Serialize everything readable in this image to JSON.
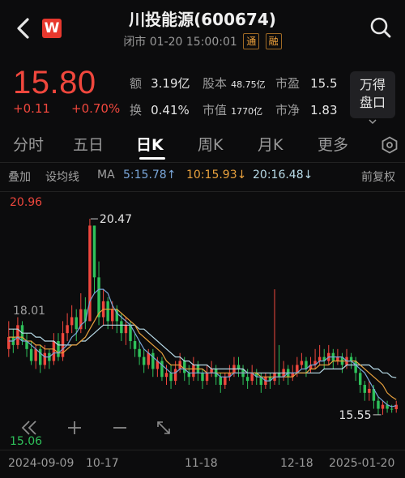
{
  "header": {
    "title": "川投能源(600674)",
    "status": "闭市 01-20 15:00:01",
    "badge1": "通",
    "badge2": "融",
    "logo_letter": "W"
  },
  "quote": {
    "price": "15.80",
    "change": "+0.11",
    "change_pct": "+0.70%",
    "amount_label": "额",
    "amount": "3.19亿",
    "equity_label": "股本",
    "equity": "48.75亿",
    "pe_label": "市盈",
    "pe": "15.5",
    "turnover_label": "换",
    "turnover": "0.41%",
    "mktcap_label": "市值",
    "mktcap": "1770亿",
    "pb_label": "市净",
    "pb": "1.83",
    "wande_line1": "万得",
    "wande_line2": "盘口"
  },
  "tabs": [
    "分时",
    "五日",
    "日K",
    "周K",
    "月K",
    "更多"
  ],
  "active_tab": "日K",
  "toolbar": {
    "overlay": "叠加",
    "drawline": "设均线",
    "ma_label": "MA",
    "ma5": "5:15.78↑",
    "ma10": "10:15.93↓",
    "ma20": "20:16.48↓",
    "adjust": "前复权"
  },
  "chart_data": {
    "type": "candlestick",
    "axis_high": "20.96",
    "axis_mid": "18.01",
    "axis_low": "15.06",
    "annotation_high": "20.47",
    "annotation_low": "15.55",
    "x_labels": [
      "2024-09-09",
      "10-17",
      "11-18",
      "12-18",
      "2025-01-20"
    ],
    "ylim": [
      15.06,
      20.96
    ],
    "colors": {
      "up": "#f0473d",
      "down": "#2ec15a",
      "ma5": "#7aa6d9",
      "ma10": "#e8a13d",
      "ma20": "#b8dbe8"
    },
    "candles": [
      [
        17.2,
        17.5,
        17.9,
        17.0
      ],
      [
        17.5,
        17.3,
        17.7,
        17.1
      ],
      [
        17.3,
        17.8,
        18.0,
        17.2
      ],
      [
        17.8,
        17.4,
        17.9,
        17.3
      ],
      [
        17.4,
        17.2,
        17.6,
        17.0
      ],
      [
        17.2,
        16.9,
        17.4,
        16.8
      ],
      [
        16.9,
        17.2,
        17.3,
        16.7
      ],
      [
        17.2,
        16.8,
        17.3,
        16.6
      ],
      [
        16.8,
        17.1,
        17.3,
        16.7
      ],
      [
        17.1,
        16.9,
        17.2,
        16.7
      ],
      [
        16.9,
        17.4,
        17.6,
        16.8
      ],
      [
        17.4,
        17.0,
        17.6,
        16.9
      ],
      [
        17.0,
        17.6,
        17.9,
        16.9
      ],
      [
        17.6,
        17.8,
        18.1,
        17.4
      ],
      [
        17.8,
        18.0,
        18.3,
        17.6
      ],
      [
        18.0,
        17.7,
        18.2,
        17.4
      ],
      [
        17.7,
        18.2,
        18.6,
        17.6
      ],
      [
        18.2,
        17.9,
        18.5,
        17.7
      ],
      [
        17.9,
        20.3,
        20.47,
        17.9
      ],
      [
        20.3,
        19.0,
        20.3,
        18.6
      ],
      [
        19.0,
        18.0,
        19.4,
        17.8
      ],
      [
        18.0,
        18.4,
        18.7,
        17.8
      ],
      [
        18.4,
        17.9,
        18.5,
        17.7
      ],
      [
        17.9,
        18.2,
        18.4,
        17.7
      ],
      [
        18.2,
        17.9,
        18.3,
        17.6
      ],
      [
        17.9,
        17.6,
        18.1,
        17.4
      ],
      [
        17.6,
        17.8,
        18.0,
        17.3
      ],
      [
        17.8,
        17.4,
        17.9,
        17.2
      ],
      [
        17.4,
        17.2,
        17.6,
        17.0
      ],
      [
        17.2,
        17.0,
        17.4,
        16.8
      ],
      [
        17.0,
        16.8,
        17.2,
        16.6
      ],
      [
        16.8,
        17.1,
        17.2,
        16.7
      ],
      [
        17.1,
        16.7,
        17.2,
        16.5
      ],
      [
        16.7,
        16.9,
        17.0,
        16.5
      ],
      [
        16.9,
        16.5,
        17.0,
        16.4
      ],
      [
        16.5,
        16.6,
        16.8,
        16.3
      ],
      [
        16.6,
        16.4,
        16.8,
        16.2
      ],
      [
        16.4,
        16.7,
        16.9,
        16.3
      ],
      [
        16.7,
        16.9,
        17.1,
        16.6
      ],
      [
        16.9,
        16.6,
        17.0,
        16.4
      ],
      [
        16.6,
        16.5,
        16.8,
        16.3
      ],
      [
        16.5,
        16.8,
        17.0,
        16.4
      ],
      [
        16.8,
        16.6,
        16.9,
        16.4
      ],
      [
        16.6,
        16.4,
        16.7,
        16.2
      ],
      [
        16.4,
        16.6,
        16.8,
        16.3
      ],
      [
        16.6,
        16.7,
        16.9,
        16.5
      ],
      [
        16.7,
        16.5,
        16.8,
        16.3
      ],
      [
        16.5,
        16.3,
        16.6,
        16.1
      ],
      [
        16.3,
        16.5,
        16.6,
        16.2
      ],
      [
        16.5,
        16.6,
        16.8,
        16.4
      ],
      [
        16.6,
        16.8,
        17.0,
        16.5
      ],
      [
        16.8,
        16.7,
        17.0,
        16.5
      ],
      [
        16.7,
        16.5,
        16.8,
        16.3
      ],
      [
        16.5,
        16.4,
        16.7,
        16.2
      ],
      [
        16.4,
        16.6,
        16.8,
        16.3
      ],
      [
        16.6,
        16.5,
        16.7,
        16.3
      ],
      [
        16.5,
        16.3,
        16.6,
        16.1
      ],
      [
        16.3,
        16.5,
        16.6,
        16.2
      ],
      [
        16.5,
        16.4,
        16.6,
        16.2
      ],
      [
        16.4,
        16.6,
        18.7,
        16.3
      ],
      [
        16.6,
        16.5,
        17.3,
        16.3
      ],
      [
        16.5,
        16.7,
        16.9,
        16.4
      ],
      [
        16.7,
        16.5,
        16.8,
        16.3
      ],
      [
        16.5,
        16.6,
        16.8,
        16.4
      ],
      [
        16.6,
        16.8,
        17.0,
        16.5
      ],
      [
        16.8,
        16.9,
        17.1,
        16.7
      ],
      [
        16.9,
        16.7,
        17.0,
        16.5
      ],
      [
        16.7,
        16.8,
        17.0,
        16.6
      ],
      [
        16.8,
        16.9,
        17.2,
        16.7
      ],
      [
        16.9,
        17.0,
        17.3,
        16.8
      ],
      [
        17.0,
        16.9,
        17.2,
        16.7
      ],
      [
        16.9,
        17.1,
        17.3,
        16.8
      ],
      [
        17.1,
        16.9,
        17.2,
        16.7
      ],
      [
        16.9,
        17.0,
        17.2,
        16.8
      ],
      [
        17.0,
        16.8,
        17.1,
        16.6
      ],
      [
        16.8,
        17.0,
        17.2,
        16.7
      ],
      [
        17.0,
        16.9,
        17.1,
        16.7
      ],
      [
        16.9,
        16.6,
        17.0,
        16.4
      ],
      [
        16.6,
        16.3,
        16.7,
        16.1
      ],
      [
        16.3,
        16.1,
        16.4,
        15.9
      ],
      [
        16.1,
        16.2,
        16.4,
        15.9
      ],
      [
        16.2,
        15.9,
        16.3,
        15.7
      ],
      [
        15.9,
        15.7,
        16.0,
        15.55
      ],
      [
        15.7,
        15.8,
        15.9,
        15.55
      ],
      [
        15.8,
        15.7,
        15.9,
        15.6
      ],
      [
        15.7,
        15.69,
        15.8,
        15.6
      ],
      [
        15.69,
        15.8,
        15.9,
        15.6
      ]
    ],
    "ma5": [
      17.4,
      17.4,
      17.5,
      17.4,
      17.4,
      17.3,
      17.2,
      17.1,
      17.0,
      17.0,
      17.1,
      17.1,
      17.2,
      17.3,
      17.5,
      17.6,
      17.8,
      17.9,
      18.4,
      18.6,
      18.7,
      18.7,
      18.6,
      18.3,
      18.1,
      18.0,
      17.9,
      17.8,
      17.6,
      17.4,
      17.2,
      17.1,
      17.0,
      16.9,
      16.8,
      16.7,
      16.6,
      16.6,
      16.7,
      16.7,
      16.6,
      16.6,
      16.6,
      16.6,
      16.6,
      16.6,
      16.6,
      16.5,
      16.5,
      16.5,
      16.6,
      16.6,
      16.6,
      16.6,
      16.6,
      16.5,
      16.5,
      16.4,
      16.4,
      16.5,
      16.5,
      16.5,
      16.6,
      16.6,
      16.6,
      16.7,
      16.7,
      16.8,
      16.8,
      16.9,
      16.9,
      17.0,
      17.0,
      17.0,
      17.0,
      16.9,
      16.9,
      16.8,
      16.7,
      16.6,
      16.4,
      16.2,
      16.0,
      15.9,
      15.8,
      15.75,
      15.78
    ],
    "ma10": [
      17.5,
      17.5,
      17.5,
      17.5,
      17.4,
      17.4,
      17.3,
      17.3,
      17.2,
      17.2,
      17.2,
      17.1,
      17.1,
      17.2,
      17.3,
      17.3,
      17.4,
      17.5,
      17.7,
      17.9,
      18.1,
      18.2,
      18.2,
      18.2,
      18.2,
      18.1,
      18.0,
      17.9,
      17.8,
      17.6,
      17.5,
      17.4,
      17.3,
      17.2,
      17.1,
      16.9,
      16.8,
      16.8,
      16.8,
      16.7,
      16.7,
      16.7,
      16.7,
      16.7,
      16.6,
      16.6,
      16.6,
      16.6,
      16.6,
      16.6,
      16.6,
      16.6,
      16.6,
      16.6,
      16.6,
      16.6,
      16.5,
      16.5,
      16.5,
      16.5,
      16.5,
      16.5,
      16.5,
      16.5,
      16.6,
      16.6,
      16.6,
      16.7,
      16.7,
      16.8,
      16.8,
      16.8,
      16.9,
      16.9,
      16.9,
      16.9,
      16.9,
      16.9,
      16.8,
      16.7,
      16.6,
      16.5,
      16.4,
      16.3,
      16.1,
      16.0,
      15.93
    ],
    "ma20": [
      17.7,
      17.7,
      17.7,
      17.6,
      17.6,
      17.6,
      17.5,
      17.5,
      17.4,
      17.4,
      17.4,
      17.3,
      17.3,
      17.3,
      17.3,
      17.3,
      17.4,
      17.4,
      17.5,
      17.6,
      17.7,
      17.8,
      17.8,
      17.8,
      17.8,
      17.8,
      17.8,
      17.8,
      17.8,
      17.7,
      17.7,
      17.6,
      17.5,
      17.4,
      17.3,
      17.2,
      17.1,
      17.0,
      17.0,
      16.9,
      16.9,
      16.8,
      16.8,
      16.8,
      16.8,
      16.7,
      16.7,
      16.7,
      16.7,
      16.7,
      16.7,
      16.7,
      16.7,
      16.6,
      16.6,
      16.6,
      16.6,
      16.6,
      16.6,
      16.6,
      16.6,
      16.6,
      16.6,
      16.6,
      16.6,
      16.6,
      16.6,
      16.6,
      16.6,
      16.6,
      16.7,
      16.7,
      16.7,
      16.7,
      16.7,
      16.8,
      16.8,
      16.8,
      16.8,
      16.8,
      16.8,
      16.7,
      16.7,
      16.6,
      16.6,
      16.5,
      16.48
    ]
  }
}
